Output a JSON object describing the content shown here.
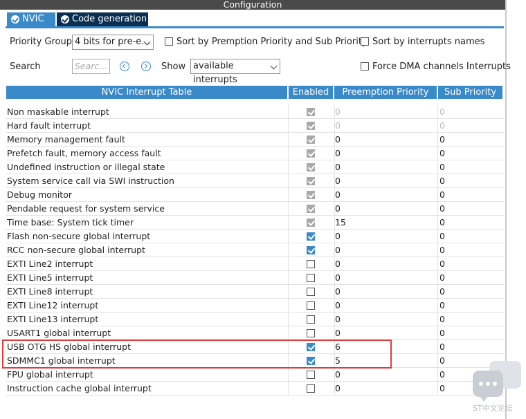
{
  "window": {
    "title": "Configuration"
  },
  "tabs": [
    {
      "label": "NVIC"
    },
    {
      "label": "Code generation"
    }
  ],
  "controls": {
    "priority_group_label": "Priority Group",
    "priority_group_value": "4 bits for pre-e...",
    "sort_premption_label": "Sort by Premption Priority and Sub Priority",
    "sort_names_label": "Sort by interrupts names",
    "search_label": "Search",
    "search_placeholder": "Searc...",
    "show_label": "Show",
    "show_value": "available interrupts",
    "force_dma_label": "Force DMA channels Interrupts"
  },
  "table": {
    "headers": {
      "name": "NVIC Interrupt Table",
      "enabled": "Enabled",
      "preemption": "Preemption Priority",
      "sub": "Sub Priority"
    },
    "rows": [
      {
        "name": "Non maskable interrupt",
        "enabled": "disabled-checked",
        "preemption": "0",
        "sub": "0",
        "dim": true
      },
      {
        "name": "Hard fault interrupt",
        "enabled": "disabled-checked",
        "preemption": "0",
        "sub": "0",
        "dim": true
      },
      {
        "name": "Memory management fault",
        "enabled": "disabled-checked",
        "preemption": "0",
        "sub": "0",
        "dim": false
      },
      {
        "name": "Prefetch fault, memory access fault",
        "enabled": "disabled-checked",
        "preemption": "0",
        "sub": "0",
        "dim": false
      },
      {
        "name": "Undefined instruction or illegal state",
        "enabled": "disabled-checked",
        "preemption": "0",
        "sub": "0",
        "dim": false
      },
      {
        "name": "System service call via SWI instruction",
        "enabled": "disabled-checked",
        "preemption": "0",
        "sub": "0",
        "dim": false
      },
      {
        "name": "Debug monitor",
        "enabled": "disabled-checked",
        "preemption": "0",
        "sub": "0",
        "dim": false
      },
      {
        "name": "Pendable request for system service",
        "enabled": "disabled-checked",
        "preemption": "0",
        "sub": "0",
        "dim": false
      },
      {
        "name": "Time base: System tick timer",
        "enabled": "disabled-checked",
        "preemption": "15",
        "sub": "0",
        "dim": false
      },
      {
        "name": "Flash non-secure global interrupt",
        "enabled": "checked",
        "preemption": "0",
        "sub": "0",
        "dim": false
      },
      {
        "name": "RCC non-secure global interrupt",
        "enabled": "checked",
        "preemption": "0",
        "sub": "0",
        "dim": false
      },
      {
        "name": "EXTI Line2 interrupt",
        "enabled": "unchecked",
        "preemption": "0",
        "sub": "0",
        "dim": false
      },
      {
        "name": "EXTI Line5 interrupt",
        "enabled": "unchecked",
        "preemption": "0",
        "sub": "0",
        "dim": false
      },
      {
        "name": "EXTI Line8 interrupt",
        "enabled": "unchecked",
        "preemption": "0",
        "sub": "0",
        "dim": false
      },
      {
        "name": "EXTI Line12 interrupt",
        "enabled": "unchecked",
        "preemption": "0",
        "sub": "0",
        "dim": false
      },
      {
        "name": "EXTI Line13 interrupt",
        "enabled": "unchecked",
        "preemption": "0",
        "sub": "0",
        "dim": false
      },
      {
        "name": "USART1 global interrupt",
        "enabled": "unchecked",
        "preemption": "0",
        "sub": "0",
        "dim": false
      },
      {
        "name": "USB OTG HS global interrupt",
        "enabled": "checked",
        "preemption": "6",
        "sub": "0",
        "dim": false
      },
      {
        "name": "SDMMC1 global interrupt",
        "enabled": "checked",
        "preemption": "5",
        "sub": "0",
        "dim": false
      },
      {
        "name": "FPU global interrupt",
        "enabled": "unchecked",
        "preemption": "0",
        "sub": "0",
        "dim": false
      },
      {
        "name": "Instruction cache global interrupt",
        "enabled": "unchecked",
        "preemption": "0",
        "sub": "0",
        "dim": false
      }
    ]
  },
  "colors": {
    "accent": "#3a89c9",
    "tab_dark": "#0a2f52",
    "highlight": "#e03b3b"
  },
  "watermark": {
    "text": "ST中文论坛"
  }
}
